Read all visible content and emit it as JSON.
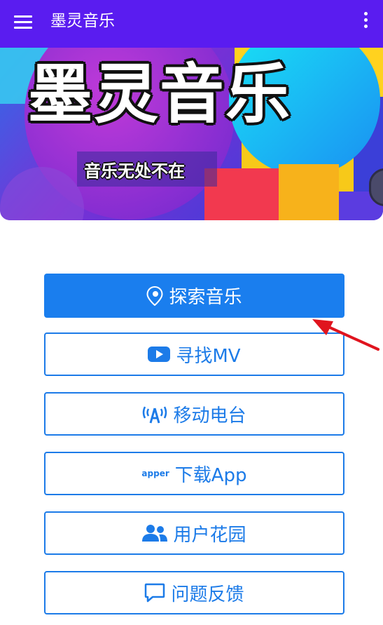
{
  "appbar": {
    "title": "墨灵音乐",
    "menu_icon": "hamburger-menu-icon",
    "more_icon": "more-vertical-icon",
    "color": "#5a1cf0"
  },
  "banner": {
    "title": "墨灵音乐",
    "slogan": "音乐无处不在"
  },
  "buttons": [
    {
      "label": "探索音乐",
      "icon": "location-pin-icon",
      "style": "primary"
    },
    {
      "label": "寻找MV",
      "icon": "youtube-icon",
      "style": "outline"
    },
    {
      "label": "移动电台",
      "icon": "radio-broadcast-icon",
      "style": "outline"
    },
    {
      "label": "下载App",
      "icon": "apper-icon",
      "icon_text": "apper",
      "style": "outline"
    },
    {
      "label": "用户花园",
      "icon": "users-icon",
      "style": "outline"
    },
    {
      "label": "问题反馈",
      "icon": "comment-icon",
      "style": "outline"
    }
  ],
  "colors": {
    "accent": "#1a7eee",
    "annotation_arrow": "#e0141e"
  }
}
